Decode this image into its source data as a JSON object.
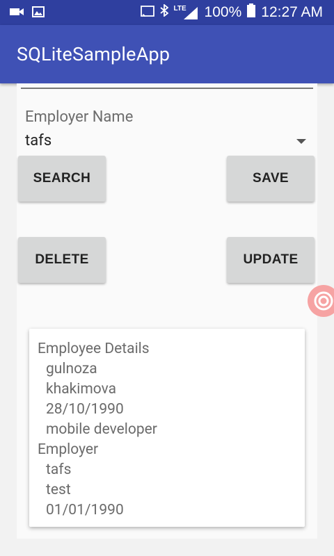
{
  "status_bar": {
    "battery": "100%",
    "time": "12:27 AM",
    "network": "LTE"
  },
  "app_bar": {
    "title": "SQLiteSampleApp"
  },
  "form": {
    "label": "Employer Name",
    "spinner_value": "tafs"
  },
  "buttons": {
    "search": "SEARCH",
    "save": "SAVE",
    "delete": "DELETE",
    "update": "UPDATE"
  },
  "details": {
    "lines": [
      "Employee Details",
      "gulnoza",
      "khakimova",
      "28/10/1990",
      "mobile developer",
      "Employer",
      "tafs",
      "test",
      "01/01/1990"
    ]
  },
  "colors": {
    "status_bar": "#2f3f9f",
    "app_bar": "#3f51b5",
    "button": "#d6d7d7",
    "floating_button": "#f6a3a3"
  }
}
